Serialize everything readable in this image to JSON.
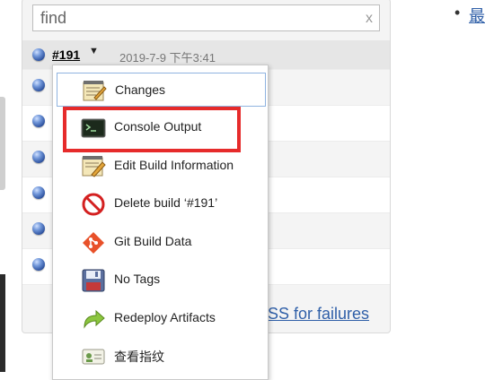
{
  "search": {
    "value": "",
    "placeholder": "find",
    "clear_glyph": "x"
  },
  "build": {
    "number": "#191",
    "time": "2019-7-9 下午3:41"
  },
  "rows_count_visible": 7,
  "rss_link": "SS for failures",
  "right_link": "最",
  "menu": {
    "items": [
      {
        "label": "Changes",
        "icon": "notepad-icon"
      },
      {
        "label": "Console Output",
        "icon": "terminal-icon"
      },
      {
        "label": "Edit Build Information",
        "icon": "notepad-edit-icon"
      },
      {
        "label": "Delete build ‘#191’",
        "icon": "no-entry-icon"
      },
      {
        "label": "Git Build Data",
        "icon": "git-icon"
      },
      {
        "label": "No Tags",
        "icon": "floppy-disk-icon"
      },
      {
        "label": "Redeploy Artifacts",
        "icon": "redeploy-arrow-icon"
      },
      {
        "label": "查看指纹",
        "icon": "fingerprint-card-icon"
      }
    ]
  },
  "colors": {
    "highlight": "#e62b2b",
    "link": "#2f5fa8",
    "ball": "#2b4f9c"
  }
}
